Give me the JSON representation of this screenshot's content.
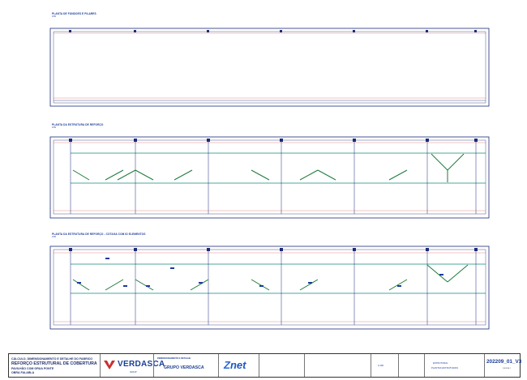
{
  "plans": [
    {
      "title": "PLANTA DE FUNDOES E PILARES",
      "scale": "1/50"
    },
    {
      "title": "PLANTA DA ESTRUTURA DE REFORÇO",
      "scale": "1/50"
    },
    {
      "title": "PLANTA DA ESTRUTURA DE REFORÇO - COTAGA COM ID ELEMENTOS",
      "scale": "1/50"
    }
  ],
  "title_block": {
    "project_lines": [
      "CÁLCULO, DIMENSIONAMENTO E DETALHE DO FABRICO",
      "REFORÇO ESTRUTURAL DE COBERTURA",
      "PAVILHÃO COM GRUA PONTE",
      "OBRA FALABLA"
    ],
    "company": "VERDASCA",
    "company_sub": "GRUP",
    "dim_detail": "DIMENSIONAMENTO E DETALHE",
    "group": "GRUPO VERDASCA",
    "partner": "net",
    "partner_prefix": "Z",
    "scale": "1/100",
    "subject_lines": [
      "ESTRUTURAL",
      "PLANTAS ESTRUTURAIS"
    ],
    "drawing_number": "202209_01_V3",
    "sheet": "PÁGINA 1"
  },
  "colors": {
    "line": "#1b2c7a",
    "beam": "#0f8a7a",
    "brace": "#1d7a3a",
    "grid_red": "#d03a3a",
    "grid_green": "#3aa66a"
  }
}
